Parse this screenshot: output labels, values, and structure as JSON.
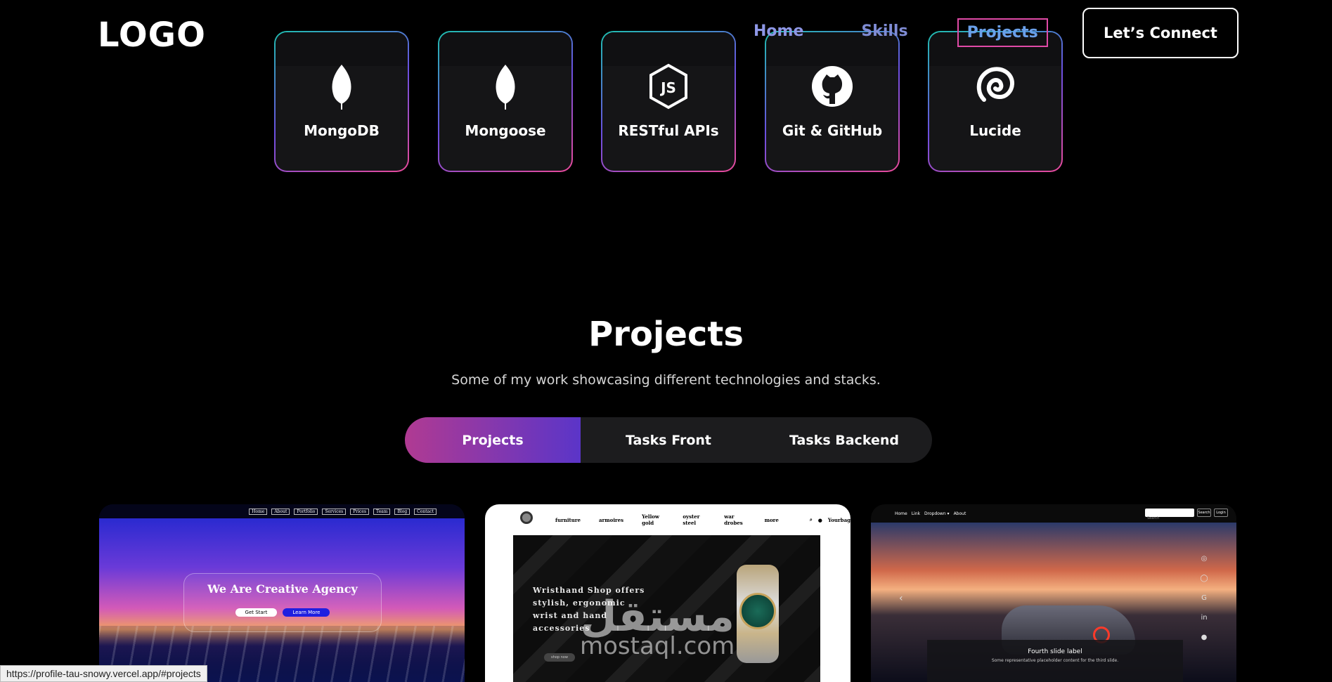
{
  "header": {
    "logo": "LOGO",
    "nav": [
      {
        "label": "Home"
      },
      {
        "label": "Skills"
      },
      {
        "label": "Projects"
      }
    ],
    "connect_label": "Let’s Connect"
  },
  "skills": [
    {
      "label": "MongoDB",
      "icon": "leaf-icon"
    },
    {
      "label": "Mongoose",
      "icon": "leaf-icon"
    },
    {
      "label": "RESTful APIs",
      "icon": "nodejs-icon"
    },
    {
      "label": "Git & GitHub",
      "icon": "github-icon"
    },
    {
      "label": "Lucide",
      "icon": "lucide-icon"
    }
  ],
  "projects": {
    "title": "Projects",
    "subtitle": "Some of my work showcasing different technologies and stacks.",
    "tabs": [
      "Projects",
      "Tasks Front",
      "Tasks Backend"
    ],
    "active_tab": "Projects"
  },
  "project_cards": {
    "p1": {
      "nav": [
        "Home",
        "About",
        "Portfolio",
        "Services",
        "Prices",
        "Team",
        "Blog",
        "Contact"
      ],
      "heading": "We Are Creative Agency",
      "btn1": "Get Start",
      "btn2": "Learn More"
    },
    "p2": {
      "nav": [
        "furniture",
        "armoires",
        "Yellow gold",
        "oyster steel",
        "war drobes",
        "more",
        "Yourbag"
      ],
      "heading": "Wristhand Shop offers stylish, ergonomic wrist and hand accessories",
      "shop": "shop now"
    },
    "p3": {
      "nav": [
        "Home",
        "Link",
        "Dropdown ▾",
        "About"
      ],
      "search_placeholder": "Search",
      "search_btn": "Search",
      "login_btn": "Login",
      "slide_title": "Fourth slide label",
      "slide_desc": "Some representative placeholder content for the third slide."
    }
  },
  "watermark": {
    "arabic": "مستقل",
    "latin": "mostaql.com"
  },
  "status_url": "https://profile-tau-snowy.vercel.app/#projects"
}
